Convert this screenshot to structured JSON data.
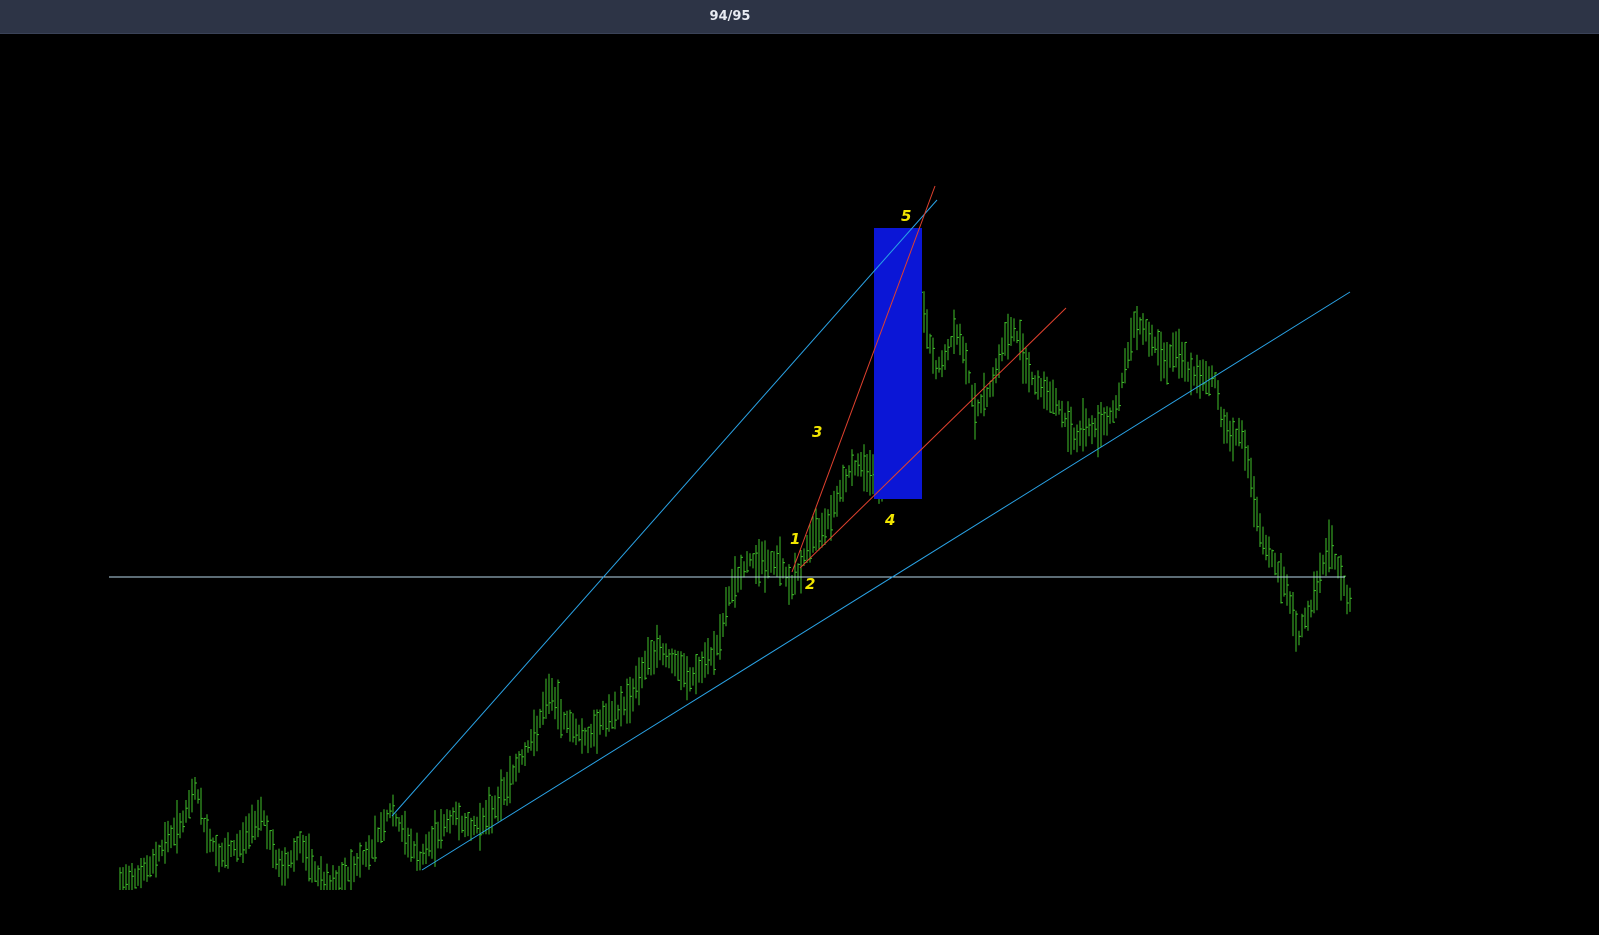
{
  "viewer": {
    "page_counter": "94/95"
  },
  "colors": {
    "background": "#000000",
    "titlebar": "#2d3446",
    "price_bars": "#3fbf2a",
    "trendline_blue": "#2aa3e6",
    "horizontal_line": "#b9d7ea",
    "trendline_red": "#e0412e",
    "highlight_box": "#0b16d6",
    "wave_labels": "#f2e600"
  },
  "annotations": {
    "wave_labels": [
      {
        "text": "1"
      },
      {
        "text": "2"
      },
      {
        "text": "3"
      },
      {
        "text": "4"
      },
      {
        "text": "5"
      }
    ]
  },
  "chart_data": {
    "type": "ohlc",
    "title": "",
    "xlabel": "",
    "ylabel": "",
    "axes_visible": false,
    "grid": false,
    "legend": "none"
  }
}
